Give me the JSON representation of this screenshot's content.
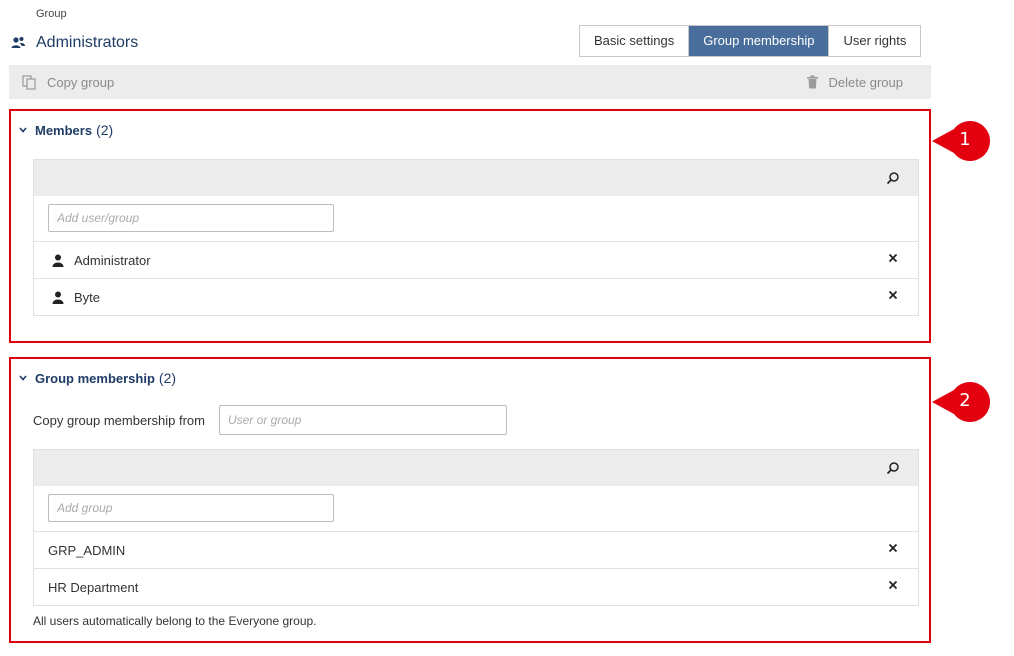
{
  "breadcrumb": "Group",
  "title": "Administrators",
  "tabs": [
    {
      "label": "Basic settings",
      "active": false
    },
    {
      "label": "Group membership",
      "active": true
    },
    {
      "label": "User rights",
      "active": false
    }
  ],
  "toolbar": {
    "copy_label": "Copy group",
    "delete_label": "Delete group"
  },
  "members": {
    "heading": "Members",
    "count": "(2)",
    "add_placeholder": "Add user/group",
    "items": [
      {
        "label": "Administrator"
      },
      {
        "label": "Byte"
      }
    ]
  },
  "membership": {
    "heading": "Group membership",
    "count": "(2)",
    "copy_from_label": "Copy group membership from",
    "copy_from_placeholder": "User or group",
    "add_placeholder": "Add group",
    "items": [
      {
        "label": "GRP_ADMIN"
      },
      {
        "label": "HR Department"
      }
    ],
    "note": "All users automatically belong to the Everyone group."
  },
  "callouts": [
    "1",
    "2"
  ],
  "colors": {
    "accent": "#4a6e9b",
    "title": "#1f3c66",
    "highlight": "#e3000f"
  },
  "icons": [
    "group-icon",
    "copy-icon",
    "trash-icon",
    "chevron-down-icon",
    "search-icon",
    "person-icon",
    "close-icon"
  ]
}
